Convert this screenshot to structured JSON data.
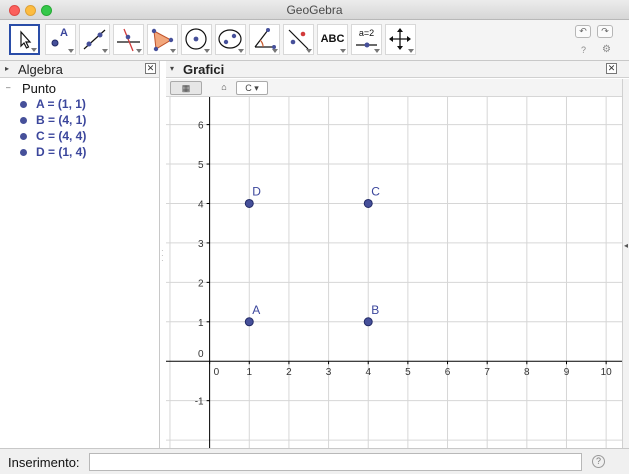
{
  "window": {
    "title": "GeoGebra"
  },
  "toolbar": {
    "tools": [
      {
        "icon": "move-arrow-icon"
      },
      {
        "icon": "new-point-icon",
        "label": "A"
      },
      {
        "icon": "line-through-points-icon"
      },
      {
        "icon": "perpendicular-line-icon"
      },
      {
        "icon": "polygon-icon"
      },
      {
        "icon": "circle-center-point-icon"
      },
      {
        "icon": "ellipse-icon"
      },
      {
        "icon": "angle-icon"
      },
      {
        "icon": "reflect-line-icon"
      },
      {
        "icon": "text-tool-icon",
        "label": "ABC"
      },
      {
        "icon": "slider-icon",
        "label": "a=2"
      },
      {
        "icon": "move-graphics-view-icon"
      }
    ],
    "undo_icon": "undo-icon",
    "redo_icon": "redo-icon",
    "help_icon": "help-icon",
    "settings_icon": "gear-icon"
  },
  "algebra": {
    "title": "Algebra",
    "category": "Punto",
    "items": [
      {
        "text": "A = (1, 1)"
      },
      {
        "text": "B = (4, 1)"
      },
      {
        "text": "C = (4, 4)"
      },
      {
        "text": "D = (1, 4)"
      }
    ]
  },
  "graphics": {
    "title": "Grafici",
    "point_color": "#46509a",
    "x_ticks": [
      "0",
      "1",
      "2",
      "3",
      "4",
      "5",
      "6",
      "7",
      "8",
      "9",
      "10"
    ],
    "y_ticks": [
      "-1",
      "1",
      "2",
      "3",
      "4",
      "5",
      "6"
    ],
    "x_range": [
      -1.1,
      10.4
    ],
    "y_range": [
      -2.2,
      6.7
    ],
    "points": [
      {
        "name": "A",
        "x": 1,
        "y": 1
      },
      {
        "name": "B",
        "x": 4,
        "y": 1
      },
      {
        "name": "C",
        "x": 4,
        "y": 4
      },
      {
        "name": "D",
        "x": 1,
        "y": 4
      }
    ]
  },
  "input": {
    "label": "Inserimento:",
    "value": "",
    "help_glyph": "?"
  }
}
